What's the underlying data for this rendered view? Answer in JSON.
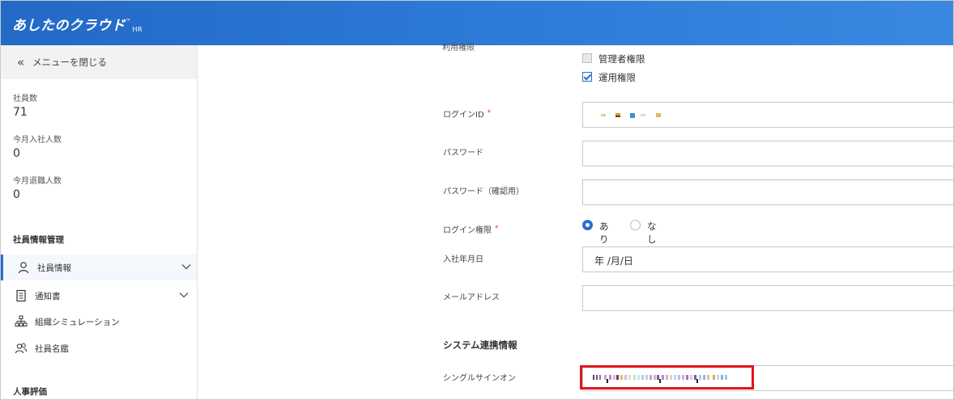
{
  "header": {
    "logo_text": "あしたのクラウド",
    "logo_tm": "™",
    "logo_suffix": "HR"
  },
  "sidebar": {
    "close_menu_label": "メニューを閉じる",
    "stats": [
      {
        "label": "社員数",
        "value": "71"
      },
      {
        "label": "今月入社人数",
        "value": "0"
      },
      {
        "label": "今月退職人数",
        "value": "0"
      }
    ],
    "section_employee": "社員情報管理",
    "items": [
      {
        "label": "社員情報",
        "icon": "person-icon",
        "active": true,
        "expandable": true
      },
      {
        "label": "通知書",
        "icon": "document-icon",
        "active": false,
        "expandable": true
      },
      {
        "label": "組織シミュレーション",
        "icon": "org-chart-icon",
        "active": false,
        "expandable": false
      },
      {
        "label": "社員名鑑",
        "icon": "people-icon",
        "active": false,
        "expandable": false
      }
    ],
    "section_evaluation": "人事評価"
  },
  "form": {
    "cut_label": "利用権限",
    "permissions": [
      {
        "label": "管理者権限",
        "checked": false
      },
      {
        "label": "運用権限",
        "checked": true
      }
    ],
    "login_id_label": "ログインID",
    "required_mark": "*",
    "login_id_value": "",
    "password_label": "パスワード",
    "password_value": "",
    "password_confirm_label": "パスワード（確認用）",
    "password_confirm_value": "",
    "login_permission_label": "ログイン権限",
    "login_permission_options": [
      {
        "label": "あり",
        "selected": true
      },
      {
        "label": "なし",
        "selected": false
      }
    ],
    "hire_date_label": "入社年月日",
    "hire_date_placeholder": "年 /月/日",
    "email_label": "メールアドレス",
    "email_value": "",
    "system_section_title": "システム連携情報",
    "sso_label": "シングルサインオン",
    "sso_value": ""
  },
  "colors": {
    "header_blue": "#2369c6",
    "accent_blue": "#2a6fcc",
    "highlight_red": "#e0141e"
  }
}
